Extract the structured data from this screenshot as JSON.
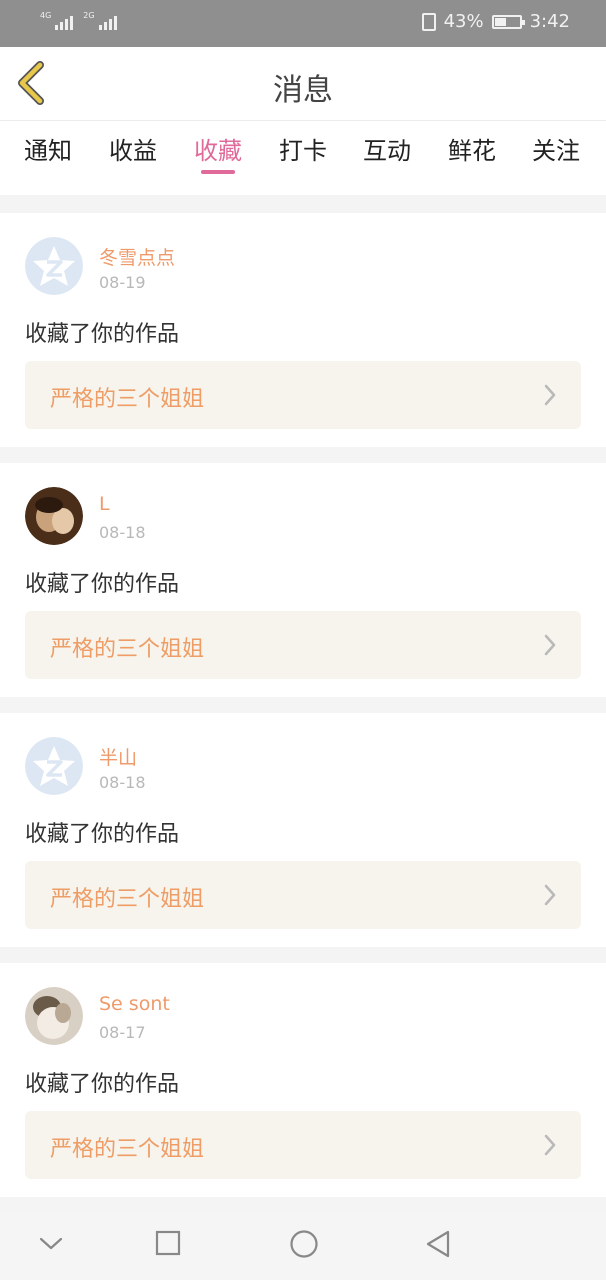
{
  "status_bar": {
    "network1": "4G",
    "network2": "2G",
    "battery_percent": "43%",
    "battery_level": 43,
    "time": "3:42",
    "icons": [
      "signal-icon",
      "vibrate-icon",
      "battery-icon"
    ]
  },
  "header": {
    "title": "消息",
    "back_icon": "chevron-left-icon"
  },
  "tabs": [
    {
      "label": "通知",
      "active": false
    },
    {
      "label": "收益",
      "active": false
    },
    {
      "label": "收藏",
      "active": true
    },
    {
      "label": "打卡",
      "active": false
    },
    {
      "label": "互动",
      "active": false
    },
    {
      "label": "鲜花",
      "active": false
    },
    {
      "label": "关注",
      "active": false
    }
  ],
  "messages": [
    {
      "user": "冬雪点点",
      "date": "08-19",
      "action": "收藏了你的作品",
      "work": "严格的三个姐姐",
      "avatar": "default-avatar"
    },
    {
      "user": "L",
      "date": "08-18",
      "action": "收藏了你的作品",
      "work": "严格的三个姐姐",
      "avatar": "photo-avatar"
    },
    {
      "user": "半山",
      "date": "08-18",
      "action": "收藏了你的作品",
      "work": "严格的三个姐姐",
      "avatar": "default-avatar"
    },
    {
      "user": "Se sont",
      "date": "08-17",
      "action": "收藏了你的作品",
      "work": "严格的三个姐姐",
      "avatar": "photo-avatar"
    }
  ],
  "colors": {
    "accent": "#e06a9a",
    "username": "#ef9a6a",
    "work_bg": "#f6f4ec",
    "back_icon": "#e8c84a"
  },
  "nav_bar": [
    "chevron-down-icon",
    "square-icon",
    "circle-icon",
    "triangle-back-icon"
  ]
}
